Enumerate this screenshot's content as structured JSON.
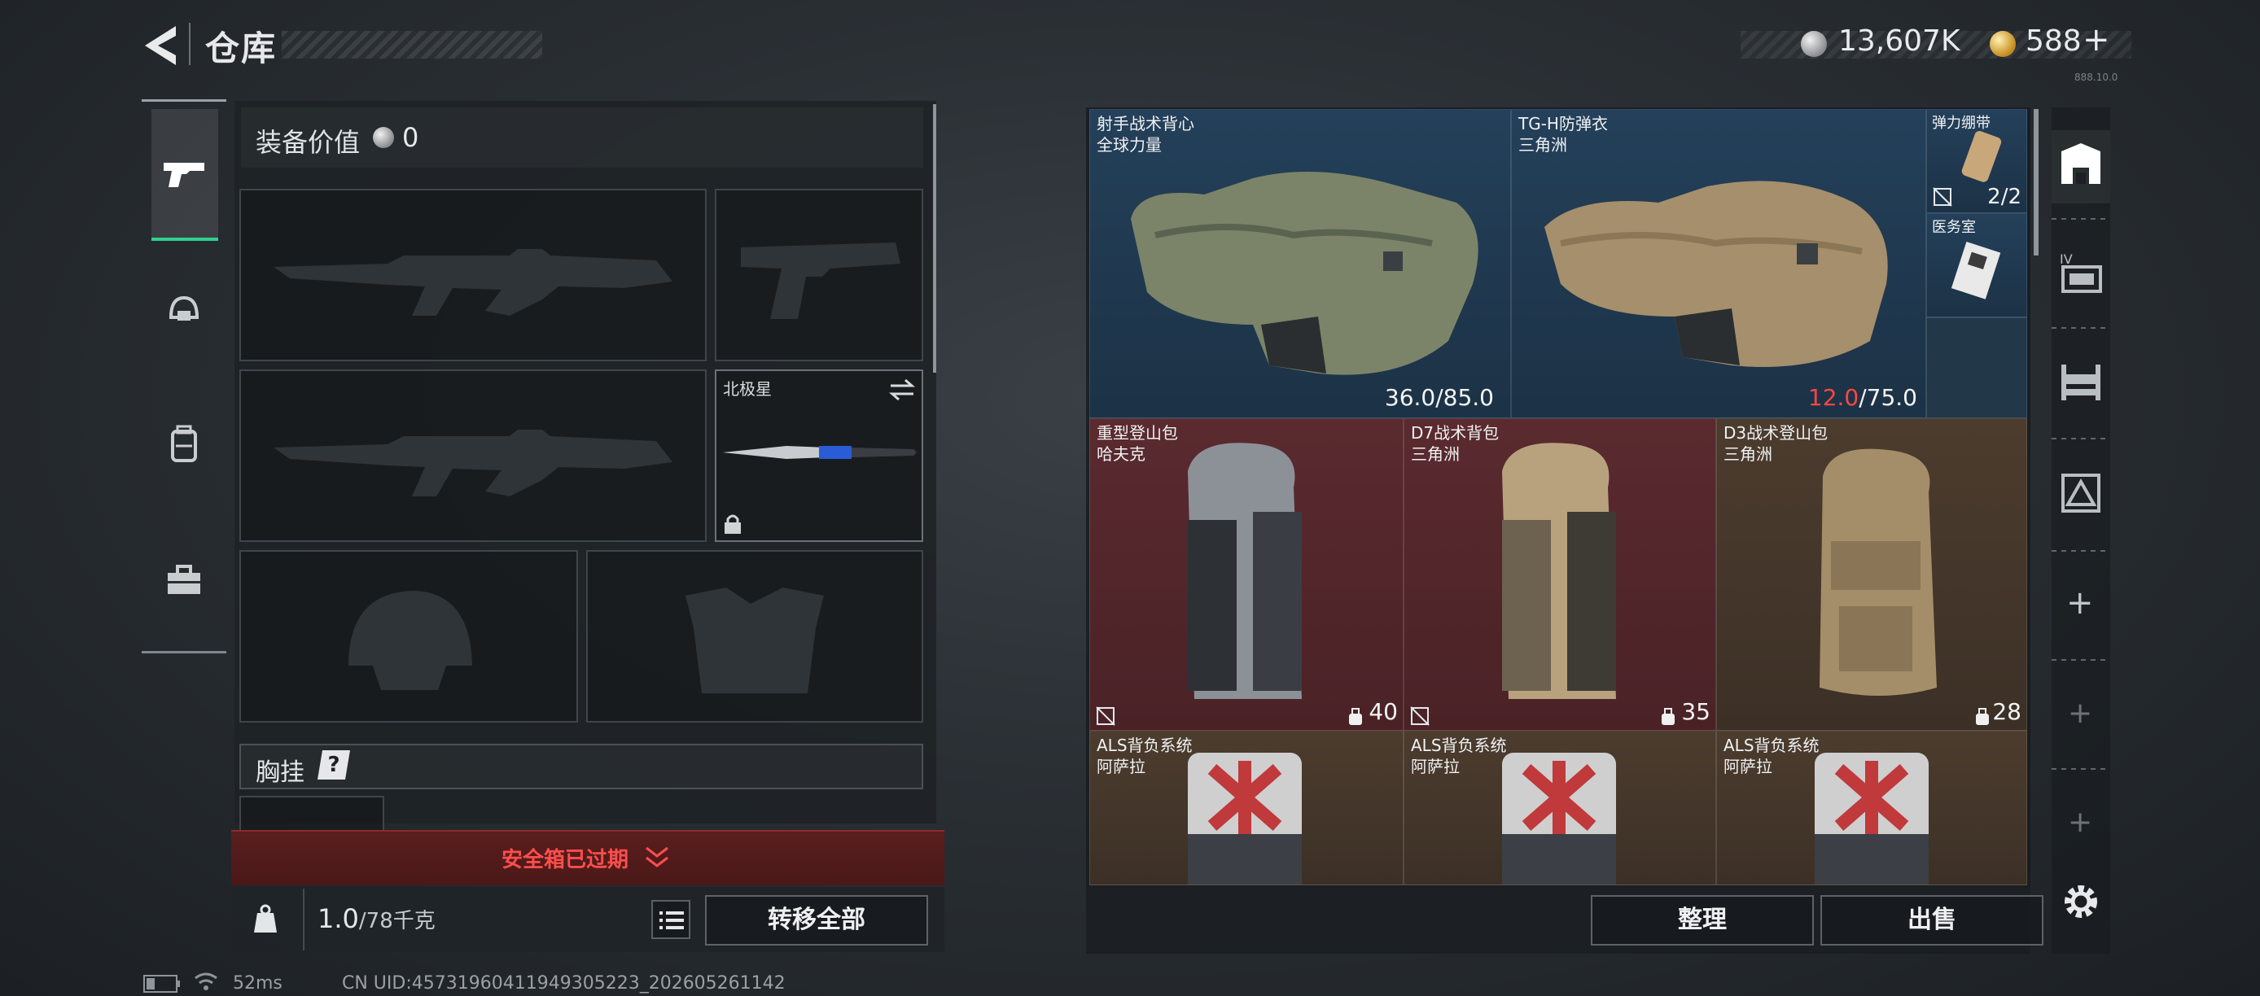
{
  "header": {
    "title": "仓库",
    "currency_silver": "13,607K",
    "currency_gold": "588",
    "currency_plus": "+",
    "version": "888.10.0"
  },
  "left_rail": {
    "items": [
      "pistol-icon",
      "helmet-icon",
      "backpack-icon",
      "toolbox-icon"
    ]
  },
  "loadout": {
    "equipment_value_label": "装备价值",
    "equipment_value": "0",
    "melee_name": "北极星",
    "chest_rig_label": "胸挂",
    "chest_rig_help": "?"
  },
  "safe_box": {
    "status": "安全箱已过期"
  },
  "bottom_left": {
    "weight_value": "1.0",
    "weight_capacity": "/78千克",
    "transfer_all": "转移全部"
  },
  "storage": {
    "armor": [
      {
        "line1": "射手战术背心",
        "line2": "全球力量",
        "cur": "36.0",
        "max": "/85.0",
        "low": false
      },
      {
        "line1": "TG-H防弹衣",
        "line2": "三角洲",
        "cur": "12.0",
        "max": "/75.0",
        "low": true
      }
    ],
    "small_items": [
      {
        "name": "弹力绷带",
        "count": "2/2"
      },
      {
        "name": "医务室",
        "count": ""
      }
    ],
    "backpacks": [
      {
        "line1": "重型登山包",
        "line2": "哈夫克",
        "cap": "40"
      },
      {
        "line1": "D7战术背包",
        "line2": "三角洲",
        "cap": "35"
      },
      {
        "line1": "D3战术登山包",
        "line2": "三角洲",
        "cap": "28"
      }
    ],
    "als": [
      {
        "line1": "ALS背负系统",
        "line2": "阿萨拉"
      },
      {
        "line1": "ALS背负系统",
        "line2": "阿萨拉"
      },
      {
        "line1": "ALS背负系统",
        "line2": "阿萨拉"
      }
    ]
  },
  "bottom_right": {
    "sort": "整理",
    "sell": "出售"
  },
  "right_rail": {
    "items": [
      "storage-home-icon",
      "storage-iv-icon",
      "storage-rack-icon",
      "storage-triangle-icon",
      "add-icon",
      "add-icon",
      "add-icon"
    ],
    "plus": "+"
  },
  "footer": {
    "ping": "52ms",
    "uid": "CN UID:45731960411949305223_202605261142"
  }
}
